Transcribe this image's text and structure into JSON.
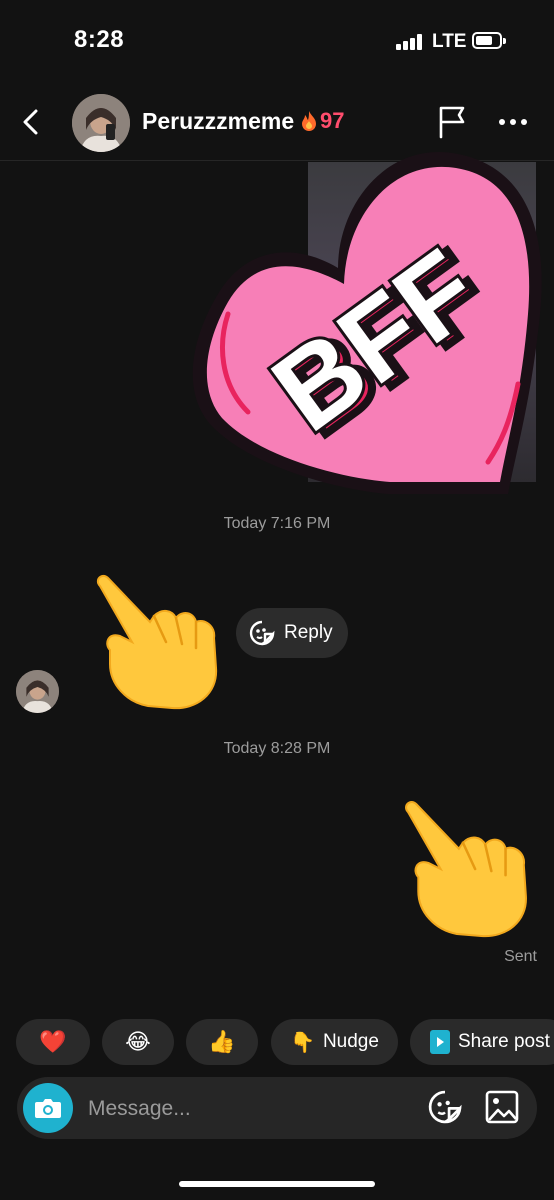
{
  "status_bar": {
    "time": "8:28",
    "network": "LTE"
  },
  "header": {
    "username": "Peruzzzmeme",
    "streak_count": "97",
    "streak_icon": "fire-icon"
  },
  "conversation": {
    "sticker_text": "BFF",
    "timestamp_1": "Today 7:16 PM",
    "reply_label": "Reply",
    "timestamp_2": "Today 8:28 PM",
    "received_emoji": "👇",
    "sent_emoji": "👇",
    "sent_status": "Sent"
  },
  "quick_replies": [
    {
      "emoji": "❤️",
      "label": ""
    },
    {
      "emoji": "😂",
      "label": ""
    },
    {
      "emoji": "👍",
      "label": ""
    },
    {
      "emoji": "👇",
      "label": "Nudge"
    },
    {
      "emoji": "",
      "label": "Share post"
    }
  ],
  "composer": {
    "placeholder": "Message..."
  },
  "colors": {
    "accent_camera": "#1fb2cf",
    "streak": "#ff4d6d",
    "heart_sticker": "#f77fb7",
    "background": "#121212"
  }
}
